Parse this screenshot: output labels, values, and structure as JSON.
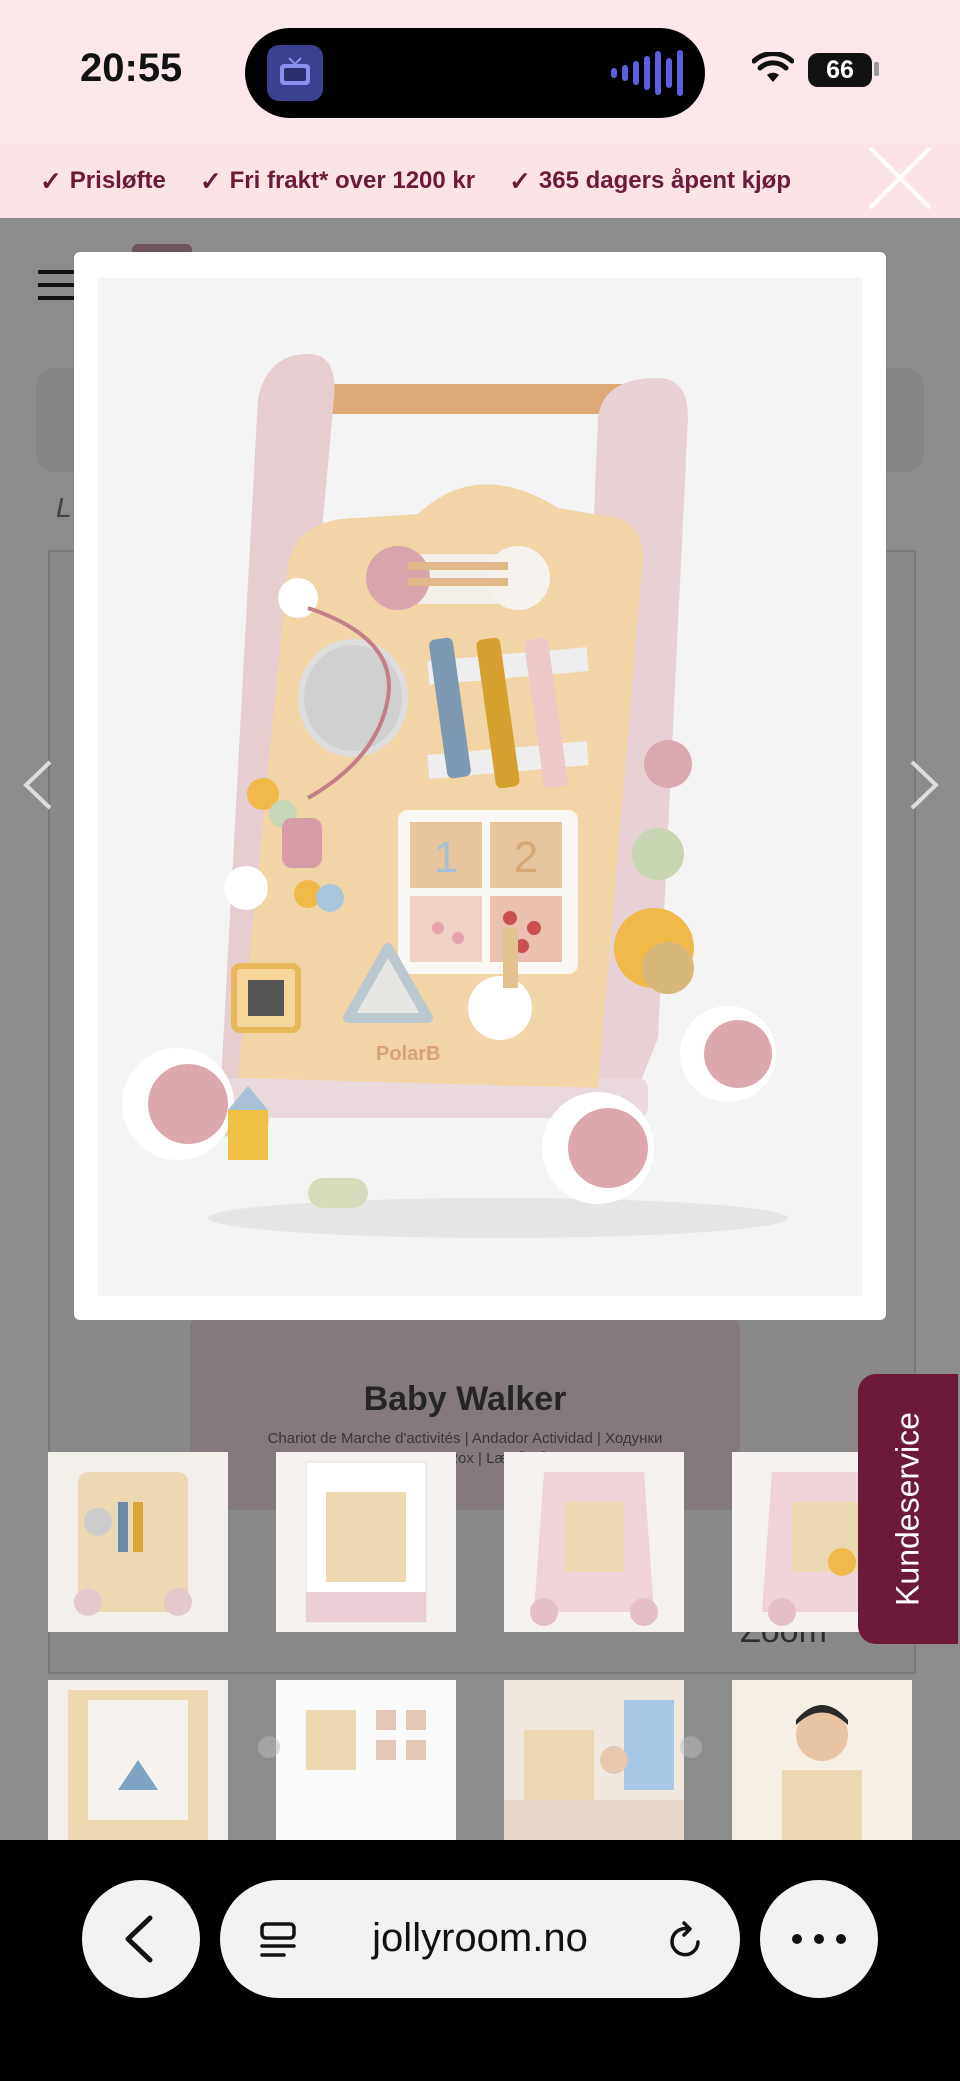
{
  "status_bar": {
    "time": "20:55",
    "battery": "66"
  },
  "promo": [
    {
      "text": "Prisløfte"
    },
    {
      "text": "Fri frakt* over 1200 kr"
    },
    {
      "text": "365 dagers åpent kjøp"
    }
  ],
  "page": {
    "breadcrumb": "L",
    "box_title": "Baby Walker",
    "box_subtitle_1": "Chariot de Marche d'activités | Andador Actividad | Ходунки",
    "box_subtitle_2": "Lauflernwagen Rox | Lær-å-gå-vogn",
    "zoom_label": "Zoom"
  },
  "product_image": {
    "brand_mark": "PolarB",
    "block_numbers": [
      "1",
      "2"
    ]
  },
  "kundeservice": "Kundeservice",
  "browser": {
    "url": "jollyroom.no"
  },
  "colors": {
    "accent": "#6d1a3a",
    "promo_bg": "#fbe3e6",
    "status_bg": "#fce8ea"
  }
}
